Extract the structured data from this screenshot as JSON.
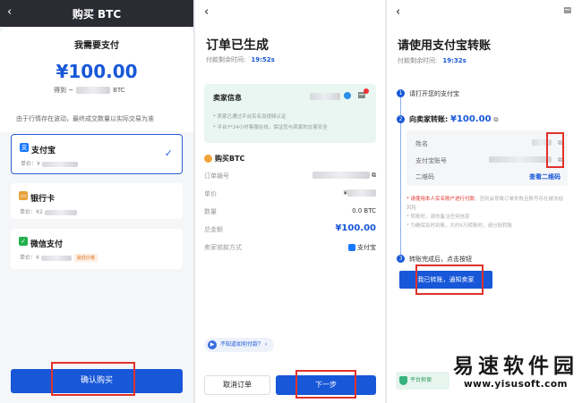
{
  "panel1": {
    "back_icon": "back-arrow-icon",
    "title": "购买 BTC",
    "subtitle": "我需要支付",
    "amount": "¥100.00",
    "get_prefix": "得到 ~",
    "get_unit": "BTC",
    "note": "由于行情存在波动，最终成交数量以实际交易为准",
    "methods": [
      {
        "name": "支付宝",
        "price_label": "单价：¥",
        "icon": "alipay-icon",
        "color": "#1677ff",
        "selected": true
      },
      {
        "name": "银行卡",
        "price_label": "单价：¥2",
        "icon": "bank-card-icon",
        "color": "#e8a23a",
        "selected": false
      },
      {
        "name": "微信支付",
        "price_label": "单价：¥",
        "tag": "最低价格",
        "icon": "wechat-pay-icon",
        "color": "#22b04b",
        "selected": false
      }
    ],
    "confirm_label": "确认购买"
  },
  "panel2": {
    "back_icon": "back-arrow-icon",
    "title": "订单已生成",
    "timer_label": "付款剩余时间:",
    "timer_value": "19:52s",
    "seller_title": "卖家信息",
    "seller_line1": "* 卖家已通过平台实名及视频认证",
    "seller_line2": "* 平台7*24小时客服在线，保证您与卖家的交易安全",
    "order_header": "购买BTC",
    "rows": [
      {
        "label": "订单编号",
        "value": ""
      },
      {
        "label": "单价",
        "value": "¥"
      },
      {
        "label": "数量",
        "value": "0.0  BTC"
      },
      {
        "label": "总金额",
        "value": "¥100.00"
      },
      {
        "label": "卖家收款方式",
        "value": "支付宝"
      }
    ],
    "help_label": "不知道如何付款？",
    "cancel_label": "取消订单",
    "next_label": "下一步"
  },
  "panel3": {
    "back_icon": "back-arrow-icon",
    "title": "请使用支付宝转账",
    "timer_label": "付款剩余时间:",
    "timer_value": "19:32s",
    "step1": "请打开您的支付宝",
    "step2_label": "向卖家转账:",
    "step2_amount": "¥100.00",
    "fields": [
      {
        "label": "姓名"
      },
      {
        "label": "支付宝账号"
      },
      {
        "label": "二维码"
      }
    ],
    "qr_link": "查看二维码",
    "warn_red": "* 请使用本人实名账户进行付款",
    "warn_rest": "，否则会导致订单失败且账号存在被冻结风险",
    "warn2": "* 转账时，请勿备注任何信息",
    "warn3": "* 为确保及时到账，大约5万转账时，请分批转账",
    "step3": "转账完成后，点击按钮",
    "done_label": "我已转账，通知卖家",
    "protect_label": "平台担保",
    "watermark_cn": "易速软件园",
    "watermark_url": "www.yisusoft.com"
  }
}
